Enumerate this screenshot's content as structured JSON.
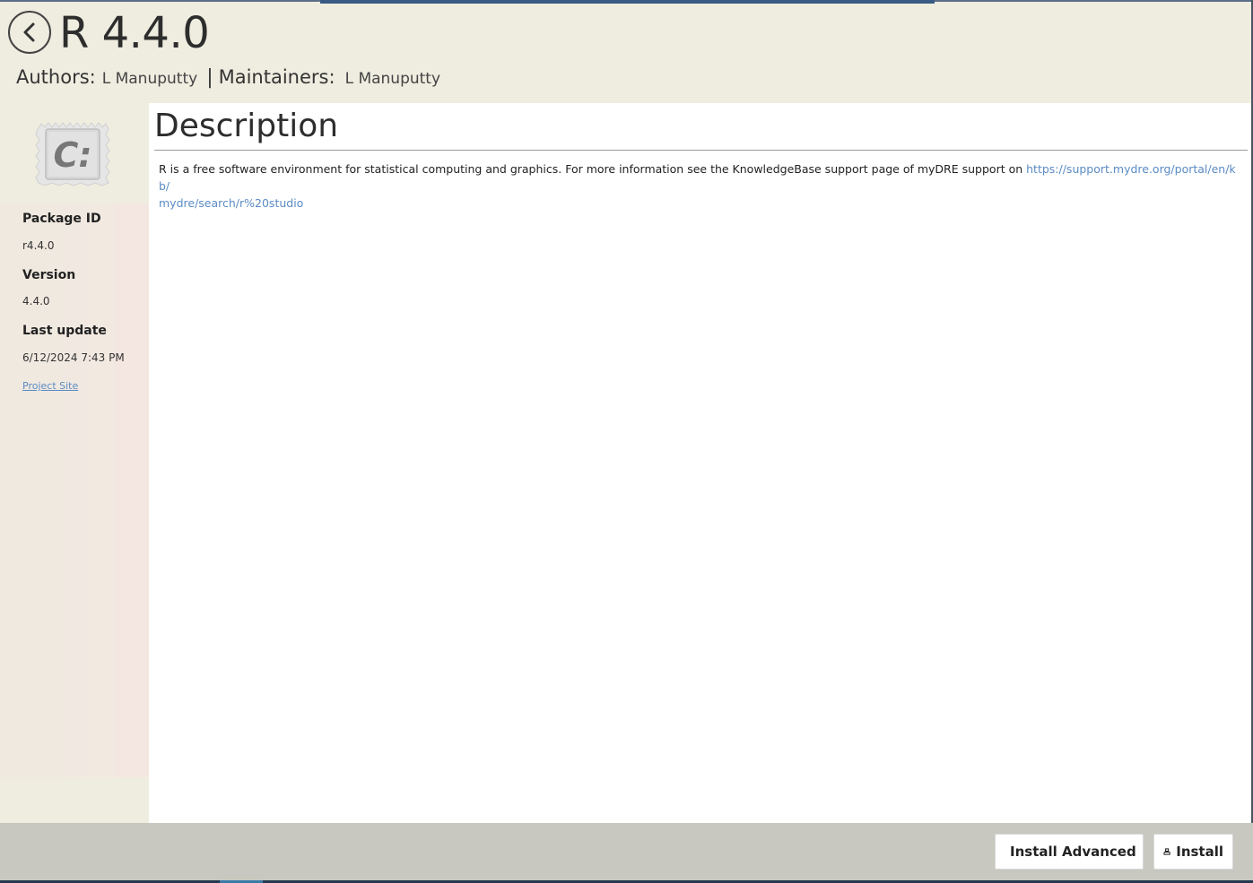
{
  "header": {
    "title": "R 4.4.0",
    "authors_label": "Authors:",
    "authors_value": "L Manuputty",
    "separator": "|",
    "maintainers_label": "Maintainers:",
    "maintainers_value": "L Manuputty"
  },
  "sidebar": {
    "package_id_label": "Package ID",
    "package_id_value": "r4.4.0",
    "version_label": "Version",
    "version_value": "4.4.0",
    "last_update_label": "Last update",
    "last_update_value": "6/12/2024 7:43 PM",
    "project_site_label": "Project Site"
  },
  "main": {
    "heading": "Description",
    "text": "R is a free software environment for statistical computing and graphics. For more information see the KnowledgeBase support page of myDRE support on ",
    "link_line1": "https://support.mydre.org/portal/en/kb/",
    "link_line2": "mydre/search/r%20studio"
  },
  "footer": {
    "install_advanced_label": "Install Advanced",
    "install_label": "Install"
  },
  "icons": {
    "back": "back-arrow-icon",
    "package": "chocolatey-package-icon",
    "install": "install-tray-icon"
  },
  "colors": {
    "link": "#5b8bc4",
    "background": "#efede0",
    "footer": "#c8c8c0"
  }
}
